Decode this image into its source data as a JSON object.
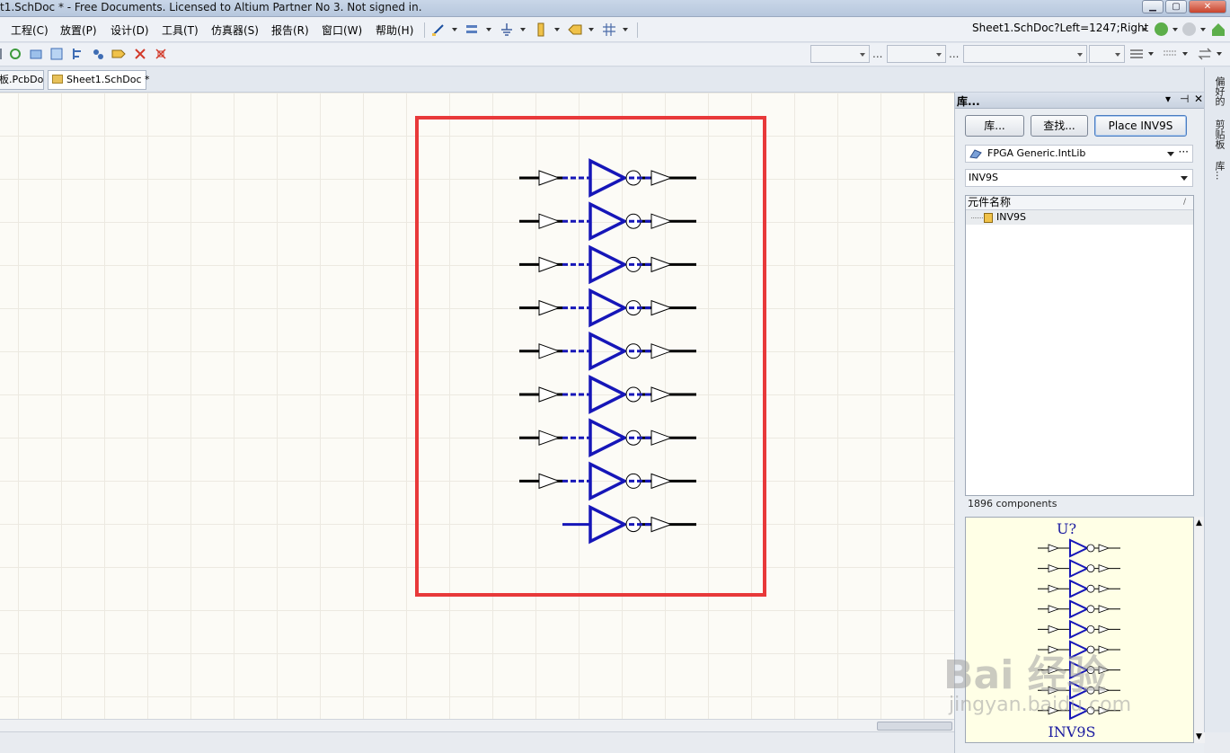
{
  "window": {
    "title": "t1.SchDoc * - Free Documents. Licensed to Altium Partner No 3. Not signed in."
  },
  "menu": [
    "工程(C)",
    "放置(P)",
    "设计(D)",
    "工具(T)",
    "仿真器(S)",
    "报告(R)",
    "窗口(W)",
    "帮助(H)"
  ],
  "address": {
    "value": "Sheet1.SchDoc?Left=1247;Right"
  },
  "tabs": [
    {
      "label": "板.PcbDoc",
      "active": false
    },
    {
      "label": "Sheet1.SchDoc *",
      "active": true
    }
  ],
  "toolbar2": {
    "dots": "..."
  },
  "library_panel": {
    "title": "库...",
    "buttons": {
      "libraries": "库...",
      "search": "查找...",
      "place": "Place INV9S"
    },
    "library_selector": "FPGA Generic.IntLib",
    "filter": "INV9S",
    "column_header": "元件名称",
    "column_sort": "/",
    "components": [
      "INV9S"
    ],
    "component_count": "1896 components",
    "preview": {
      "designator": "U?",
      "comment": "INV9S"
    }
  },
  "dock_tabs": [
    "偏好的",
    "剪贴板",
    "库..."
  ],
  "watermark": {
    "brand": "Bai 经验",
    "url": "jingyan.baidu.com"
  },
  "colors": {
    "selection_box": "#e8393a",
    "symbol_blue": "#1616b8",
    "canvas_bg": "#fcfbf6"
  }
}
